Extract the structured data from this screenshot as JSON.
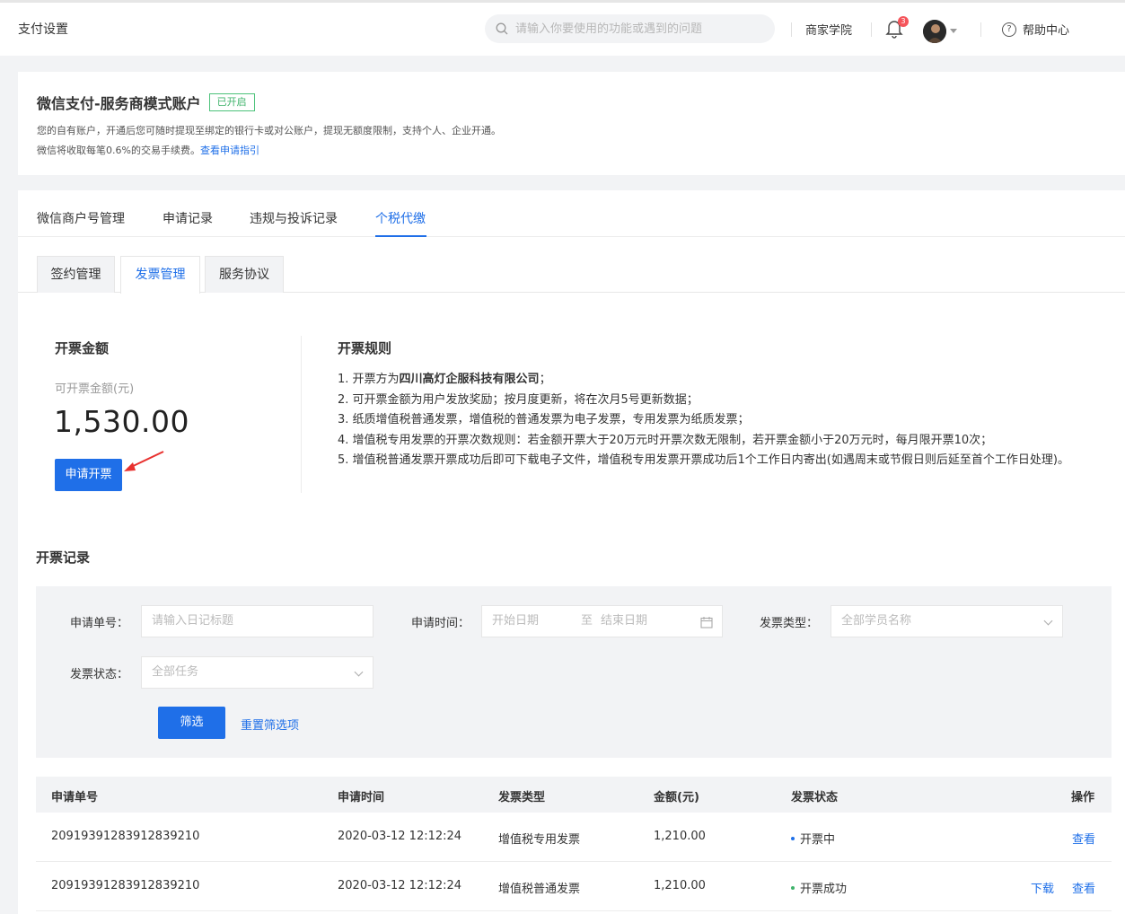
{
  "header": {
    "title": "支付设置",
    "search_placeholder": "请输入你要使用的功能或遇到的问题",
    "academy": "商家学院",
    "notification_count": "3",
    "help": "帮助中心"
  },
  "account": {
    "title": "微信支付-服务商模式账户",
    "status": "已开启",
    "desc1": "您的自有账户，开通后您可随时提现至绑定的银行卡或对公账户，提现无额度限制，支持个人、企业开通。",
    "desc2": "微信将收取每笔0.6%的交易手续费。",
    "guide_link": "查看申请指引"
  },
  "tabs": [
    "微信商户号管理",
    "申请记录",
    "违规与投诉记录",
    "个税代缴"
  ],
  "subtabs": [
    "签约管理",
    "发票管理",
    "服务协议"
  ],
  "amount": {
    "title": "开票金额",
    "label": "可开票金额(元)",
    "value": "1,530.00",
    "apply_button": "申请开票"
  },
  "rules": {
    "title": "开票规则",
    "r1_prefix": "1. 开票方为",
    "r1_bold": "四川高灯企服科技有限公司",
    "r1_suffix": "；",
    "r2": "2. 可开票金额为用户发放奖励；按月度更新，将在次月5号更新数据；",
    "r3": "3. 纸质增值税普通发票，增值税的普通发票为电子发票，专用发票为纸质发票；",
    "r4": "4. 增值税专用发票的开票次数规则：若金额开票大于20万元时开票次数无限制，若开票金额小于20万元时，每月限开票10次；",
    "r5": "5. 增值税普通发票开票成功后即可下载电子文件，增值税专用发票开票成功后1个工作日内寄出(如遇周末或节假日则后延至首个工作日处理)。"
  },
  "records": {
    "title": "开票记录",
    "filters": {
      "order_label": "申请单号：",
      "order_placeholder": "请输入日记标题",
      "time_label": "申请时间：",
      "start_placeholder": "开始日期",
      "to": "至",
      "end_placeholder": "结束日期",
      "type_label": "发票类型：",
      "type_value": "全部学员名称",
      "status_label": "发票状态：",
      "status_value": "全部任务",
      "filter_button": "筛选",
      "reset_link": "重置筛选项"
    },
    "columns": [
      "申请单号",
      "申请时间",
      "发票类型",
      "金额(元)",
      "发票状态",
      "操作"
    ],
    "rows": [
      {
        "id": "209193912839128392​10",
        "time": "2020-03-12 12:12:24",
        "type": "增值税专用发票",
        "amount": "1,210.00",
        "status": "开票中",
        "status_color": "#1f6fe8",
        "download": "",
        "view": "查看"
      },
      {
        "id": "209193912839128392​10",
        "time": "2020-03-12 12:12:24",
        "type": "增值税普通发票",
        "amount": "1,210.00",
        "status": "开票成功",
        "status_color": "#3fb36b",
        "download": "下载",
        "view": "查看"
      }
    ]
  },
  "colors": {
    "accent": "#1f6fe8",
    "success": "#3fb36b",
    "badge": "#f5555b"
  }
}
